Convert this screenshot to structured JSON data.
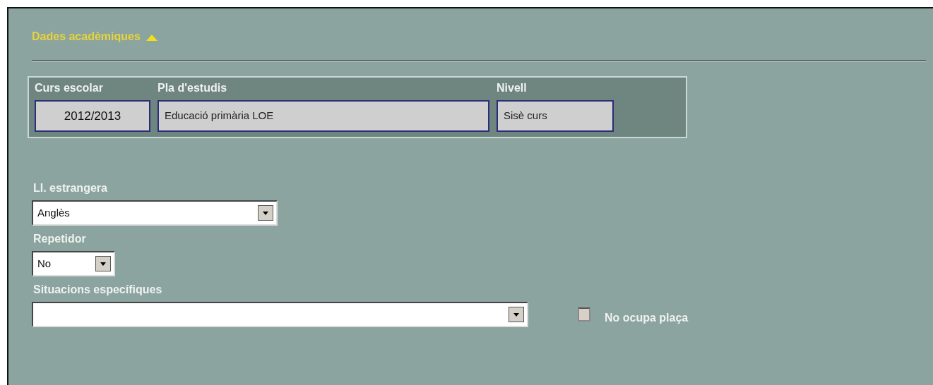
{
  "section": {
    "title": "Dades acadèmiques",
    "expanded": true
  },
  "course_box": {
    "fields": [
      {
        "label": "Curs escolar",
        "value": "2012/2013",
        "kind": "plain"
      },
      {
        "label": "Pla d'estudis",
        "value": "Educació primària LOE",
        "kind": "readonly"
      },
      {
        "label": "Nivell",
        "value": "Sisè curs",
        "kind": "readonly"
      }
    ]
  },
  "selects": [
    {
      "label": "Ll. estrangera",
      "value": "Anglès"
    },
    {
      "label": "Repetidor",
      "value": "No"
    },
    {
      "label": "Situacions específiques"
    }
  ],
  "checkbox": {
    "label": "No ocupa plaça",
    "checked": false
  }
}
